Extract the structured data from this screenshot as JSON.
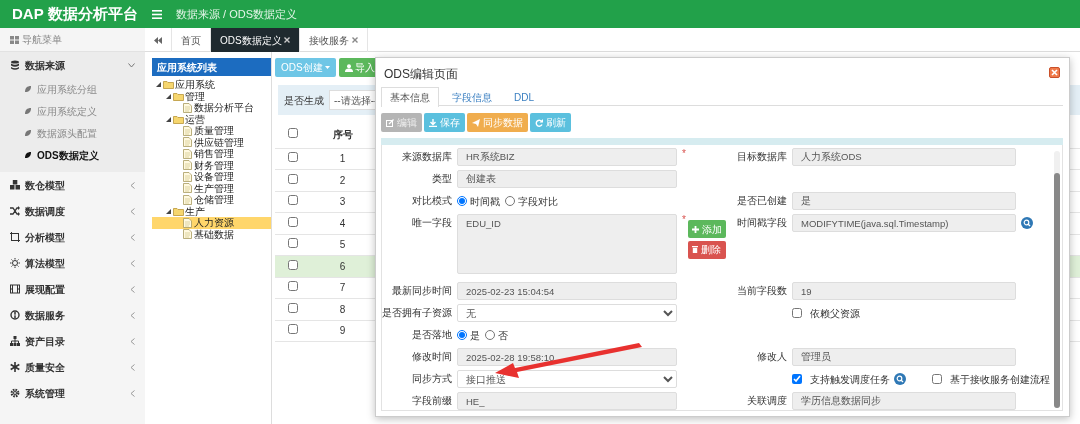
{
  "header": {
    "brand": "DAP 数据分析平台",
    "breadcrumb": "数据来源 / ODS数据定义"
  },
  "sidebar": {
    "title": "导航菜单",
    "items": [
      {
        "label": "数据来源",
        "expanded": true,
        "children": [
          {
            "label": "应用系统分组",
            "selected": false
          },
          {
            "label": "应用系统定义",
            "selected": false
          },
          {
            "label": "数据源头配置",
            "selected": false
          },
          {
            "label": "ODS数据定义",
            "selected": true
          }
        ]
      },
      {
        "label": "数仓模型",
        "expanded": false
      },
      {
        "label": "数据调度",
        "expanded": false
      },
      {
        "label": "分析模型",
        "expanded": false
      },
      {
        "label": "算法模型",
        "expanded": false
      },
      {
        "label": "展现配置",
        "expanded": false
      },
      {
        "label": "数据服务",
        "expanded": false
      },
      {
        "label": "资产目录",
        "expanded": false
      },
      {
        "label": "质量安全",
        "expanded": false
      },
      {
        "label": "系统管理",
        "expanded": false
      }
    ]
  },
  "tabs": [
    {
      "label": "首页",
      "selected": false,
      "closable": false
    },
    {
      "label": "ODS数据定义",
      "selected": true,
      "closable": true
    },
    {
      "label": "接收服务",
      "selected": false,
      "closable": true
    }
  ],
  "tree": {
    "title": "应用系统列表",
    "nodes": [
      {
        "label": "应用系统",
        "kind": "folder",
        "expanded": true,
        "selected": false,
        "children": [
          {
            "label": "管理",
            "kind": "folder",
            "expanded": true,
            "selected": false,
            "children": [
              {
                "label": "数据分析平台",
                "kind": "file",
                "selected": false
              }
            ]
          },
          {
            "label": "运营",
            "kind": "folder",
            "expanded": true,
            "selected": false,
            "children": [
              {
                "label": "质量管理",
                "kind": "file",
                "selected": false
              },
              {
                "label": "供应链管理",
                "kind": "file",
                "selected": false
              },
              {
                "label": "销售管理",
                "kind": "file",
                "selected": false
              },
              {
                "label": "财务管理",
                "kind": "file",
                "selected": false
              },
              {
                "label": "设备管理",
                "kind": "file",
                "selected": false
              },
              {
                "label": "生产管理",
                "kind": "file",
                "selected": false
              },
              {
                "label": "仓储管理",
                "kind": "file",
                "selected": false
              }
            ]
          },
          {
            "label": "生产",
            "kind": "folder",
            "expanded": true,
            "selected": false,
            "children": [
              {
                "label": "人力资源",
                "kind": "file",
                "selected": true
              },
              {
                "label": "基础数据",
                "kind": "file",
                "selected": false
              }
            ]
          }
        ]
      }
    ]
  },
  "toolbar": [
    {
      "label": "ODS创建",
      "kind": "dropdown"
    },
    {
      "label": "导入",
      "kind": "import"
    }
  ],
  "filter": {
    "label": "是否生成",
    "value": "--请选择--"
  },
  "table": {
    "all_selected": false,
    "columns": [
      "序号"
    ],
    "rows": [
      {
        "number": "1",
        "checked": false,
        "selected": false
      },
      {
        "number": "2",
        "checked": false,
        "selected": false
      },
      {
        "number": "3",
        "checked": false,
        "selected": false
      },
      {
        "number": "4",
        "checked": false,
        "selected": false
      },
      {
        "number": "5",
        "checked": false,
        "selected": false
      },
      {
        "number": "6",
        "checked": false,
        "selected": true
      },
      {
        "number": "7",
        "checked": false,
        "selected": false
      },
      {
        "number": "8",
        "checked": false,
        "selected": false
      },
      {
        "number": "9",
        "checked": false,
        "selected": false
      }
    ]
  },
  "modal": {
    "title": "ODS编辑页面",
    "tabs": [
      {
        "label": "基本信息",
        "selected": true
      },
      {
        "label": "字段信息",
        "selected": false
      },
      {
        "label": "DDL",
        "selected": false
      }
    ],
    "buttons": [
      {
        "label": "编辑",
        "kind": "edit",
        "disabled": true
      },
      {
        "label": "保存",
        "kind": "save",
        "disabled": false
      },
      {
        "label": "同步数据",
        "kind": "sync",
        "disabled": false
      },
      {
        "label": "刷新",
        "kind": "refresh",
        "disabled": false
      }
    ],
    "form": [
      {
        "left": {
          "label": "来源数据库",
          "kind": "input",
          "value": "HR系统BIZ",
          "required_mark": "*"
        },
        "right": {
          "label": "目标数据库",
          "kind": "input",
          "value": "人力系统ODS"
        }
      },
      {
        "left": {
          "label": "类型",
          "kind": "input",
          "value": "创建表"
        }
      },
      {
        "left": {
          "label": "对比模式",
          "kind": "radio",
          "options": [
            {
              "label": "时间戳",
              "selected": true
            },
            {
              "label": "字段对比",
              "selected": false
            }
          ]
        },
        "right": {
          "label": "是否已创建",
          "kind": "input",
          "value": "是"
        }
      },
      {
        "left": {
          "label": "唯一字段",
          "kind": "textarea",
          "value": "EDU_ID",
          "required_mark": "*",
          "buttons": [
            {
              "label": "添加",
              "kind": "add"
            },
            {
              "label": "删除",
              "kind": "delete"
            }
          ]
        },
        "right": {
          "label": "时间戳字段",
          "kind": "input",
          "value": "MODIFYTIME(java.sql.Timestamp)",
          "lookup": true
        }
      },
      {
        "left": {
          "label": "最新同步时间",
          "kind": "input",
          "value": "2025-02-23 15:04:54"
        },
        "right": {
          "label": "当前字段数",
          "kind": "input",
          "value": "19"
        }
      },
      {
        "left": {
          "label": "是否拥有子资源",
          "kind": "select",
          "value": "无"
        },
        "right": {
          "kind": "checkbox",
          "options": [
            {
              "label": "依赖父资源",
              "checked": false,
              "lookup": false
            }
          ]
        }
      },
      {
        "left": {
          "label": "是否落地",
          "kind": "radio",
          "options": [
            {
              "label": "是",
              "selected": true
            },
            {
              "label": "否",
              "selected": false
            }
          ]
        }
      },
      {
        "left": {
          "label": "修改时间",
          "kind": "input",
          "value": "2025-02-28 19:58:10"
        },
        "right": {
          "label": "修改人",
          "kind": "input",
          "value": "管理员"
        }
      },
      {
        "left": {
          "label": "同步方式",
          "kind": "select",
          "value": "接口推送"
        },
        "right": {
          "kind": "checkbox",
          "options": [
            {
              "label": "支持触发调度任务",
              "checked": true,
              "lookup": true
            },
            {
              "label": "基于接收服务创建流程",
              "checked": false,
              "lookup": false
            }
          ]
        }
      },
      {
        "left": {
          "label": "字段前缀",
          "kind": "input",
          "value": "HE_"
        },
        "right": {
          "label": "关联调度",
          "kind": "input",
          "value": "学历信息数据同步"
        }
      }
    ]
  }
}
